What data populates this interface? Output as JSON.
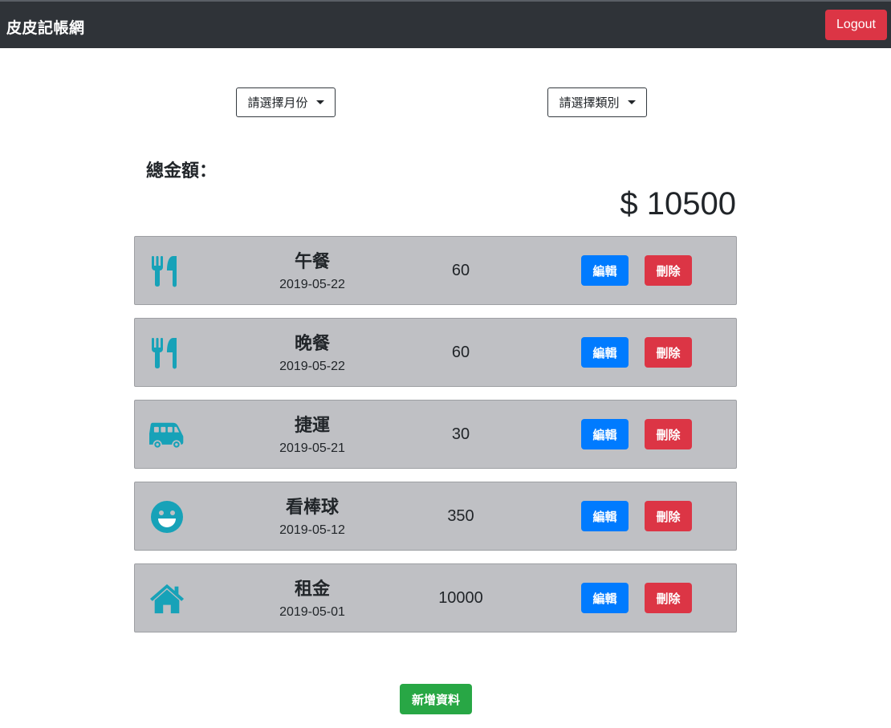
{
  "navbar": {
    "brand": "皮皮記帳網",
    "logout_label": "Logout"
  },
  "filters": {
    "month_label": "請選擇月份",
    "category_label": "請選擇類別"
  },
  "summary": {
    "total_label": "總金額：",
    "total_value": "$ 10500"
  },
  "records": [
    {
      "icon": "utensils-icon",
      "name": "午餐",
      "date": "2019-05-22",
      "amount": "60",
      "edit_label": "編輯",
      "delete_label": "刪除"
    },
    {
      "icon": "utensils-icon",
      "name": "晚餐",
      "date": "2019-05-22",
      "amount": "60",
      "edit_label": "編輯",
      "delete_label": "刪除"
    },
    {
      "icon": "bus-icon",
      "name": "捷運",
      "date": "2019-05-21",
      "amount": "30",
      "edit_label": "編輯",
      "delete_label": "刪除"
    },
    {
      "icon": "smile-icon",
      "name": "看棒球",
      "date": "2019-05-12",
      "amount": "350",
      "edit_label": "編輯",
      "delete_label": "刪除"
    },
    {
      "icon": "home-icon",
      "name": "租金",
      "date": "2019-05-01",
      "amount": "10000",
      "edit_label": "編輯",
      "delete_label": "刪除"
    }
  ],
  "add_button_label": "新增資料",
  "colors": {
    "navbar": "#2f3338",
    "icon": "#17a2b8",
    "record_bg": "#bfc0c4",
    "edit": "#007bff",
    "delete": "#dc3545",
    "add": "#28a745"
  }
}
